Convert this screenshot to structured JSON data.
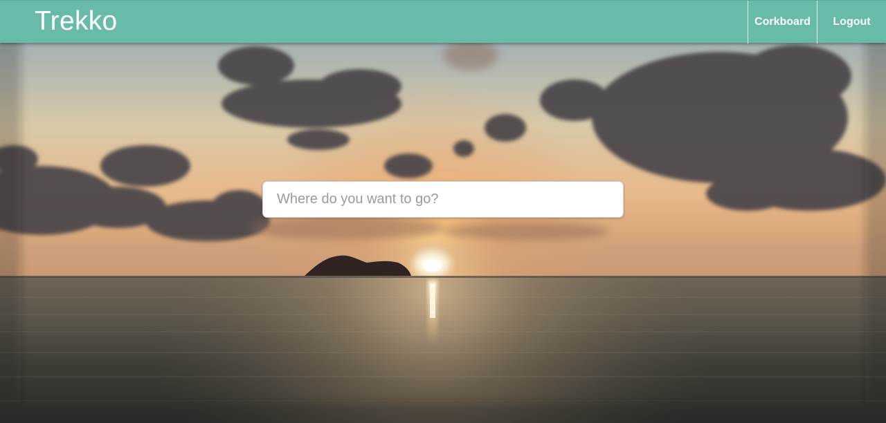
{
  "navbar": {
    "brand": "Trekko",
    "links": [
      {
        "label": "Corkboard"
      },
      {
        "label": "Logout"
      }
    ],
    "color": "#67bba8"
  },
  "search": {
    "placeholder": "Where do you want to go?",
    "value": ""
  },
  "hero": {
    "image_description_icon": "sunset-sea-background"
  }
}
